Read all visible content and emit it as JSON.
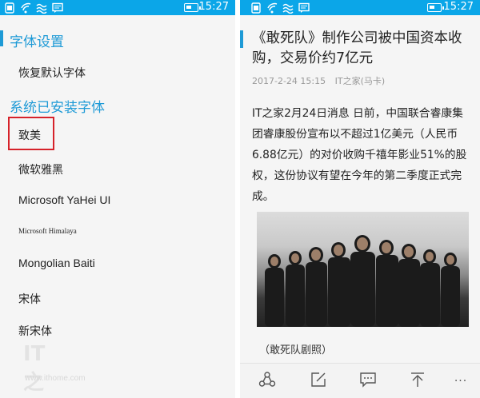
{
  "status_bar": {
    "time": "15:27"
  },
  "font_settings": {
    "section_title": "字体设置",
    "reset_label": "恢复默认字体",
    "installed_title": "系统已安装字体",
    "fonts": [
      {
        "label": "致美",
        "selected": true
      },
      {
        "label": "微软雅黑"
      },
      {
        "label": "Microsoft YaHei UI"
      },
      {
        "label": "Microsoft Himalaya"
      },
      {
        "label": "Mongolian Baiti"
      },
      {
        "label": "宋体"
      },
      {
        "label": "新宋体"
      }
    ]
  },
  "watermark": {
    "logo": "IT之",
    "url": "www.ithome.com"
  },
  "article": {
    "headline": "《敢死队》制作公司被中国资本收购，交易价约7亿元",
    "date": "2017-2-24 15:15",
    "source": "IT之家(马卡)",
    "body": "IT之家2月24日消息 日前，中国联合睿康集团睿康股份宣布以不超过1亿美元（人民币6.88亿元）的对价收购千禧年影业51%的股权，这份协议有望在今年的第二季度正式完成。",
    "caption": "（敢死队剧照）"
  },
  "toolbar": {
    "share_icon": "share-icon",
    "edit_icon": "edit-icon",
    "comment_icon": "comment-icon",
    "top_icon": "scroll-top-icon",
    "more_label": "···"
  },
  "colors": {
    "status_bar": "#0ba6e8",
    "accent": "#1e9ad6",
    "highlight": "#d6222a"
  }
}
